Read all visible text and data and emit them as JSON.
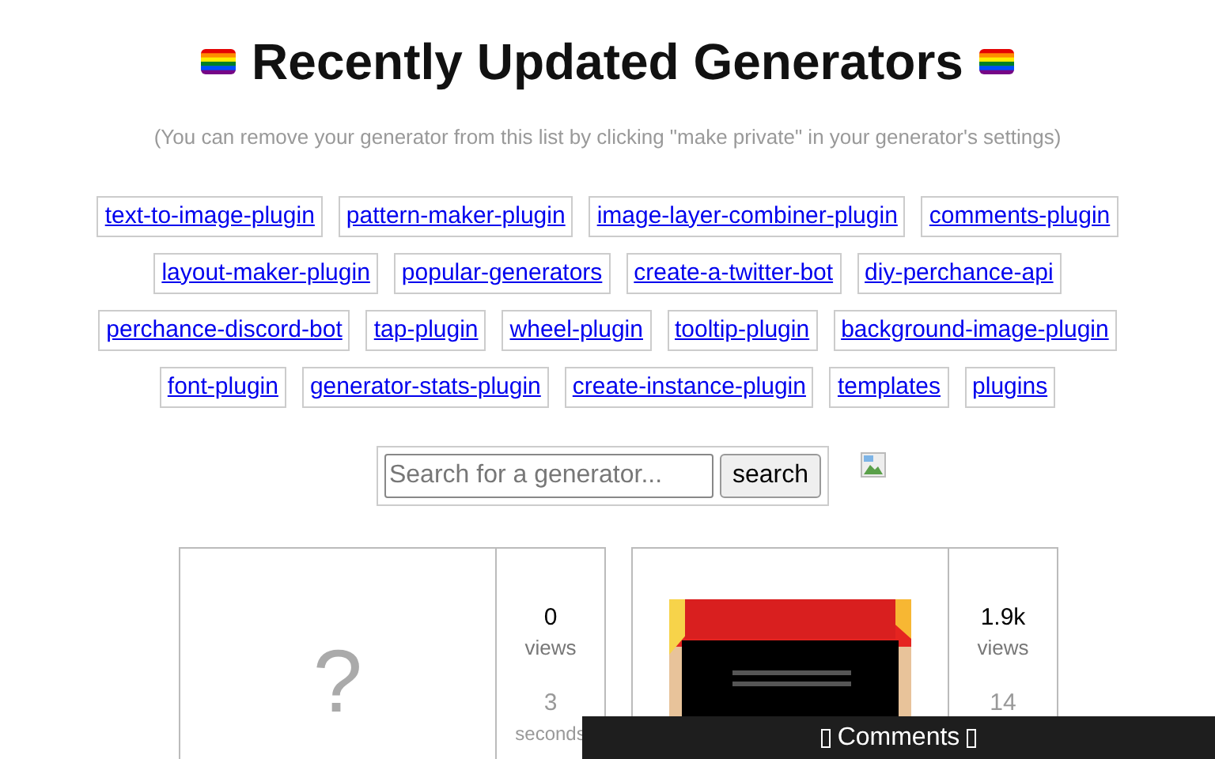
{
  "title": "Recently Updated Generators",
  "subtitle": "(You can remove your generator from this list by clicking \"make private\" in your generator's settings)",
  "tag_rows": [
    [
      "text-to-image-plugin",
      "pattern-maker-plugin",
      "image-layer-combiner-plugin",
      "comments-plugin"
    ],
    [
      "layout-maker-plugin",
      "popular-generators",
      "create-a-twitter-bot",
      "diy-perchance-api"
    ],
    [
      "perchance-discord-bot",
      "tap-plugin",
      "wheel-plugin",
      "tooltip-plugin",
      "background-image-plugin"
    ],
    [
      "font-plugin",
      "generator-stats-plugin",
      "create-instance-plugin",
      "templates",
      "plugins"
    ]
  ],
  "search": {
    "placeholder": "Search for a generator...",
    "button": "search"
  },
  "cards": [
    {
      "kind": "placeholder",
      "placeholder_mark": "?",
      "views": "0",
      "views_label": "views",
      "age": "3",
      "age_unit": "seconds"
    },
    {
      "kind": "picture",
      "views": "1.9k",
      "views_label": "views",
      "age": "14"
    }
  ],
  "comments_bar": {
    "label": "Comments"
  }
}
